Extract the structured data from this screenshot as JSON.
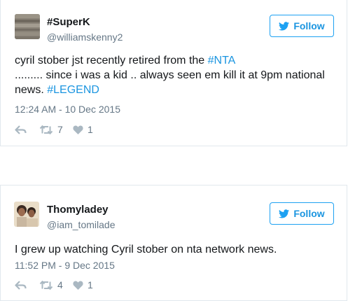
{
  "tweets": [
    {
      "display_name": "#SuperK",
      "handle": "@williamskenny2",
      "follow_label": "Follow",
      "text_parts": {
        "p1": "cyril stober jst recently retired from the ",
        "h1": "#NTA",
        "p2": "......... since i was a kid .. always seen em kill it at 9pm national news.  ",
        "h2": "#LEGEND"
      },
      "timestamp": "12:24 AM - 10 Dec 2015",
      "retweets": "7",
      "likes": "1"
    },
    {
      "display_name": "Thomyladey",
      "handle": "@iam_tomilade",
      "follow_label": "Follow",
      "text": "I grew up watching Cyril stober on nta network news.",
      "timestamp": "11:52 PM - 9 Dec 2015",
      "retweets": "4",
      "likes": "1"
    }
  ],
  "colors": {
    "accent": "#1da1f2",
    "link": "#1b95e0",
    "muted": "#657786",
    "icon": "#aab8c2",
    "text": "#14171a"
  },
  "icons": [
    "twitter-bird-icon",
    "reply-icon",
    "retweet-icon",
    "heart-icon"
  ]
}
